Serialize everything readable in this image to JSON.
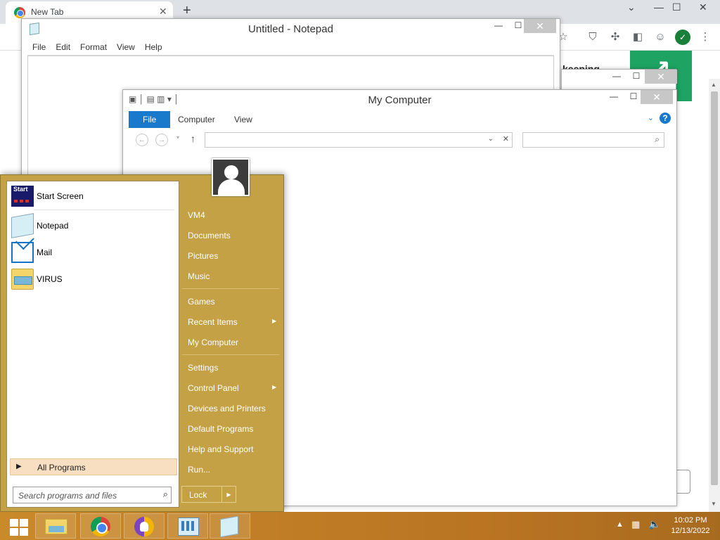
{
  "browser": {
    "tab_title": "New Tab",
    "close_glyph": "✕",
    "newtab_glyph": "+",
    "page_partial_text": "keeping",
    "page_arrow": "↗",
    "toolbar_icons": [
      "star-icon",
      "shield-icon",
      "puzzle-icon",
      "sidebar-icon",
      "profile-icon",
      "shield-check-icon",
      "menu-icon"
    ],
    "accent": "#1ea362"
  },
  "notepad": {
    "title": "Untitled - Notepad",
    "menu": [
      "File",
      "Edit",
      "Format",
      "View",
      "Help"
    ]
  },
  "mycomputer": {
    "title": "My Computer",
    "tabs": [
      "File",
      "Computer",
      "View"
    ],
    "help": "?",
    "accent": "#1979ca"
  },
  "window_controls": {
    "minimize": "—",
    "maximize": "☐",
    "close": "✕"
  },
  "startmenu": {
    "programs": [
      {
        "label": "Start Screen",
        "icon": "start-screen-icon"
      },
      {
        "label": "Notepad",
        "icon": "notepad-icon"
      },
      {
        "label": "Mail",
        "icon": "mail-icon"
      },
      {
        "label": "VIRUS",
        "icon": "folder-icon"
      }
    ],
    "start_icon_text": "Start",
    "all_programs": "All Programs",
    "search_placeholder": "Search programs and files",
    "links": [
      "VM4",
      "Documents",
      "Pictures",
      "Music",
      "Games",
      "Recent Items",
      "My Computer",
      "Settings",
      "Control Panel",
      "Devices and Printers",
      "Default Programs",
      "Help and Support",
      "Run..."
    ],
    "lock": "Lock",
    "color": "#c4a145"
  },
  "taskbar": {
    "apps": [
      "start-button",
      "file-explorer",
      "google-chrome",
      "vpn-app",
      "control-panel",
      "notepad"
    ],
    "time": "10:02 PM",
    "date": "12/13/2022",
    "tray_arrow": "▲"
  }
}
